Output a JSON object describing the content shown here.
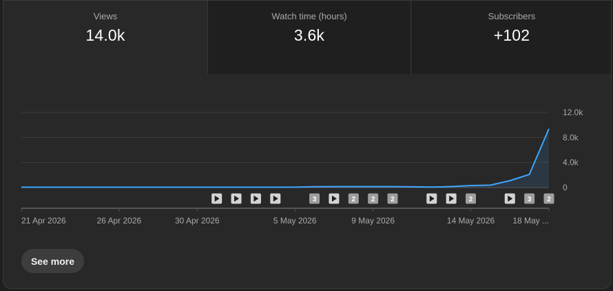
{
  "tabs": [
    {
      "label": "Views",
      "value": "14.0k"
    },
    {
      "label": "Watch time (hours)",
      "value": "3.6k"
    },
    {
      "label": "Subscribers",
      "value": "+102"
    }
  ],
  "see_more_label": "See more",
  "colors": {
    "line": "#3ea6ff",
    "background": "#282828"
  },
  "chart_data": {
    "type": "area",
    "x_start": "21 Apr 2026",
    "y_ticks": [
      "12.0k",
      "8.0k",
      "4.0k",
      "0"
    ],
    "ylim": [
      0,
      12000
    ],
    "x_tick_labels": [
      "21 Apr 2026",
      "26 Apr 2026",
      "30 Apr 2026",
      "5 May 2026",
      "9 May 2026",
      "14 May 2026",
      "18 May ..."
    ],
    "x_tick_days": [
      0,
      5,
      9,
      14,
      18,
      23,
      27
    ],
    "series": [
      {
        "values": [
          60,
          60,
          60,
          60,
          60,
          60,
          60,
          60,
          60,
          60,
          60,
          60,
          60,
          60,
          70,
          130,
          150,
          150,
          150,
          150,
          120,
          80,
          160,
          320,
          380,
          1100,
          2100,
          9400
        ]
      }
    ],
    "upload_markers": [
      {
        "day": 10,
        "kind": "play"
      },
      {
        "day": 11,
        "kind": "play"
      },
      {
        "day": 12,
        "kind": "play"
      },
      {
        "day": 13,
        "kind": "play"
      },
      {
        "day": 15,
        "kind": "count",
        "label": "3"
      },
      {
        "day": 16,
        "kind": "play"
      },
      {
        "day": 17,
        "kind": "count",
        "label": "2"
      },
      {
        "day": 18,
        "kind": "count",
        "label": "2"
      },
      {
        "day": 19,
        "kind": "count",
        "label": "2"
      },
      {
        "day": 21,
        "kind": "play"
      },
      {
        "day": 22,
        "kind": "play"
      },
      {
        "day": 23,
        "kind": "count",
        "label": "2"
      },
      {
        "day": 25,
        "kind": "play"
      },
      {
        "day": 26,
        "kind": "count",
        "label": "3"
      },
      {
        "day": 27,
        "kind": "count",
        "label": "2"
      }
    ],
    "grid": true,
    "legend": "none"
  }
}
